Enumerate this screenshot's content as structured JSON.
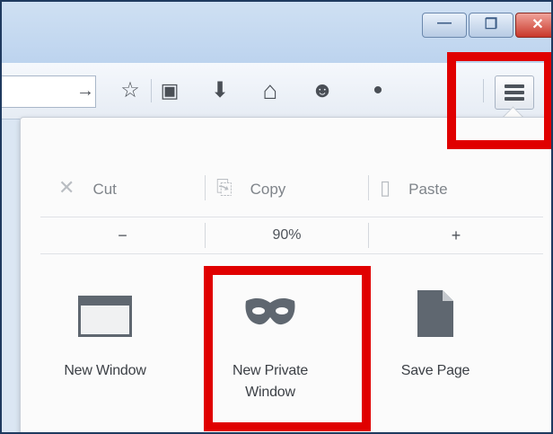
{
  "window": {
    "caption_buttons": [
      {
        "name": "minimize",
        "glyph": "—"
      },
      {
        "name": "restore",
        "glyph": "❐"
      },
      {
        "name": "close",
        "glyph": "✕"
      }
    ]
  },
  "toolbar": {
    "icons": [
      {
        "name": "go-arrow-icon",
        "glyph": "→"
      },
      {
        "name": "bookmark-star-icon",
        "glyph": "☆"
      },
      {
        "name": "reading-list-icon",
        "glyph": "▣"
      },
      {
        "name": "download-icon",
        "glyph": "⬇"
      },
      {
        "name": "home-icon",
        "glyph": "⌂"
      },
      {
        "name": "chat-icon",
        "glyph": "☻"
      },
      {
        "name": "overflow-icon",
        "glyph": "•"
      }
    ]
  },
  "panel": {
    "edit": {
      "cut": {
        "label": "Cut",
        "icon": "✕"
      },
      "copy": {
        "label": "Copy",
        "icon": "⎘"
      },
      "paste": {
        "label": "Paste",
        "icon": "▯"
      }
    },
    "zoom": {
      "out": "−",
      "level": "90%",
      "in": "+"
    },
    "buttons": {
      "new_window": "New Window",
      "new_private_window_line1": "New Private",
      "new_private_window_line2": "Window",
      "save_page": "Save Page"
    }
  },
  "colors": {
    "highlight": "#e00000",
    "icon_gray": "#5f6770"
  }
}
